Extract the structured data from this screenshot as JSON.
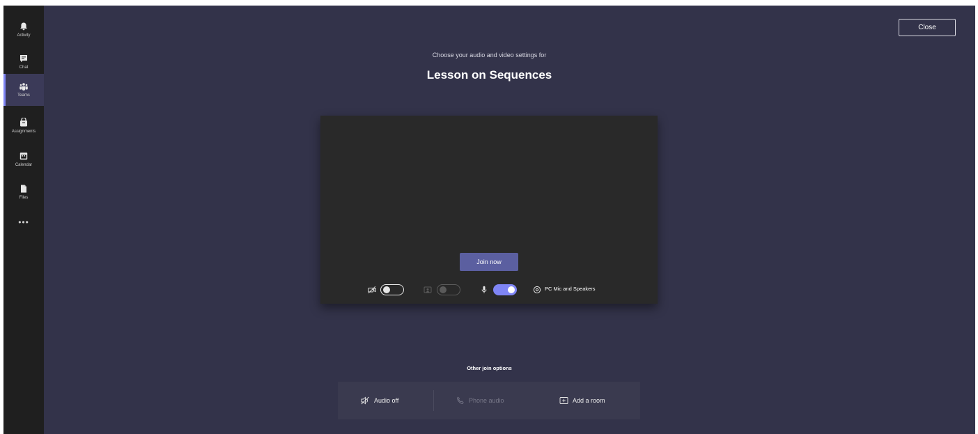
{
  "sidebar": {
    "items": [
      {
        "label": "Activity",
        "icon": "bell-icon",
        "active": false
      },
      {
        "label": "Chat",
        "icon": "chat-icon",
        "active": false
      },
      {
        "label": "Teams",
        "icon": "teams-icon",
        "active": true
      },
      {
        "label": "Assignments",
        "icon": "assignments-icon",
        "active": false
      },
      {
        "label": "Calendar",
        "icon": "calendar-icon",
        "active": false
      },
      {
        "label": "Files",
        "icon": "files-icon",
        "active": false
      }
    ],
    "more": "•••"
  },
  "header": {
    "close_label": "Close",
    "subtitle": "Choose your audio and video settings for",
    "meeting_title": "Lesson on Sequences"
  },
  "preview": {
    "join_label": "Join now",
    "device_label": "PC Mic and Speakers",
    "camera_on": false,
    "blur_enabled": false,
    "mic_on": true
  },
  "other_options": {
    "title": "Other join options",
    "audio_off": "Audio off",
    "phone_audio": "Phone audio",
    "add_room": "Add a room"
  },
  "colors": {
    "background": "#33334a",
    "rail": "#1f1f1f",
    "accent": "#7f85f5",
    "join_button": "#5b5fa0"
  }
}
